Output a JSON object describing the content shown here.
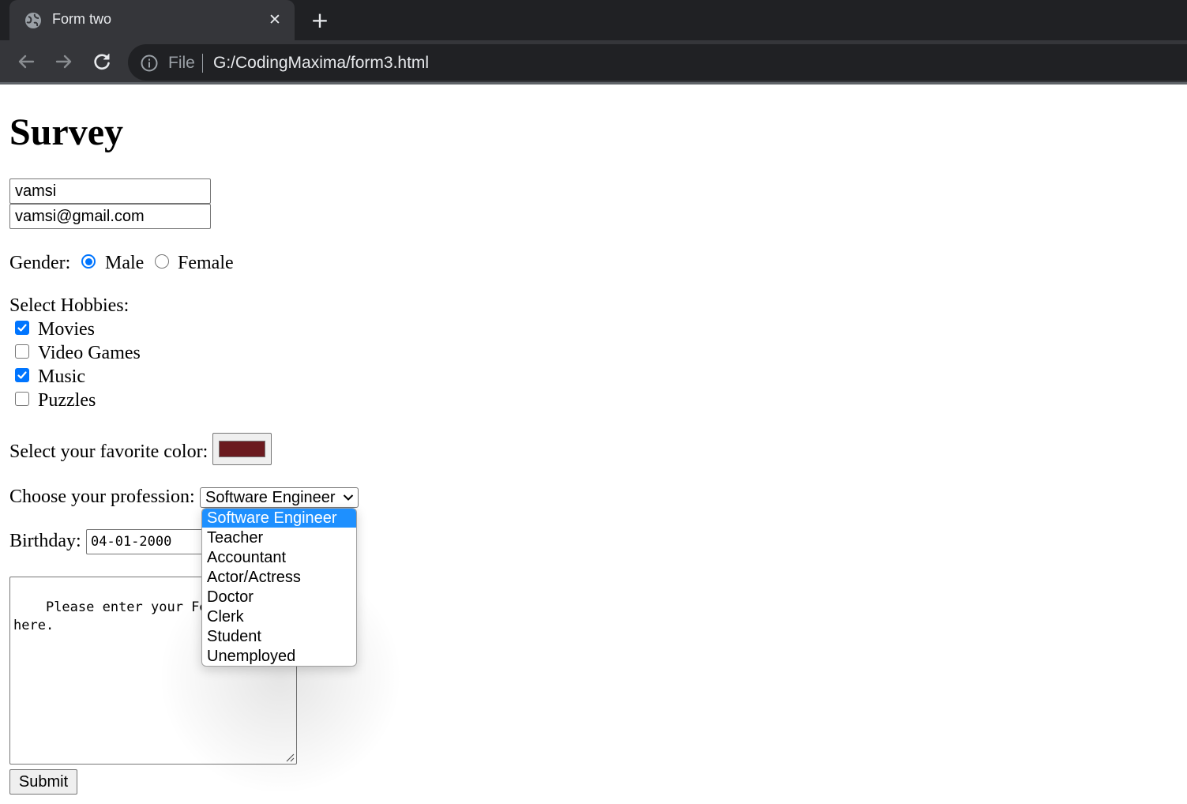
{
  "browser": {
    "tab_title": "Form two",
    "tab_close": "✕",
    "new_tab": "+",
    "scheme_label": "File",
    "url": "G:/CodingMaxima/form3.html"
  },
  "page": {
    "heading": "Survey",
    "name_value": "vamsi",
    "email_value": "vamsi@gmail.com",
    "gender": {
      "label": "Gender:",
      "options": [
        "Male",
        "Female"
      ],
      "selected": "Male"
    },
    "hobbies": {
      "label": "Select Hobbies:",
      "items": [
        {
          "label": "Movies",
          "checked": true
        },
        {
          "label": "Video Games",
          "checked": false
        },
        {
          "label": "Music",
          "checked": true
        },
        {
          "label": "Puzzles",
          "checked": false
        }
      ]
    },
    "color": {
      "label": "Select your favorite color:",
      "value": "#6b1a1f"
    },
    "profession": {
      "label": "Choose your profession:",
      "selected": "Software Engineer",
      "options": [
        "Software Engineer",
        "Teacher",
        "Accountant",
        "Actor/Actress",
        "Doctor",
        "Clerk",
        "Student",
        "Unemployed"
      ]
    },
    "birthday": {
      "label": "Birthday:",
      "value": "04-01-2000"
    },
    "feedback_value": "Please enter your Feed\nhere.",
    "submit_label": "Submit"
  },
  "colors": {
    "accent": "#0075ff",
    "selected_option": "#1e90ff",
    "chrome_dark": "#202124",
    "chrome_tab": "#35363a"
  }
}
